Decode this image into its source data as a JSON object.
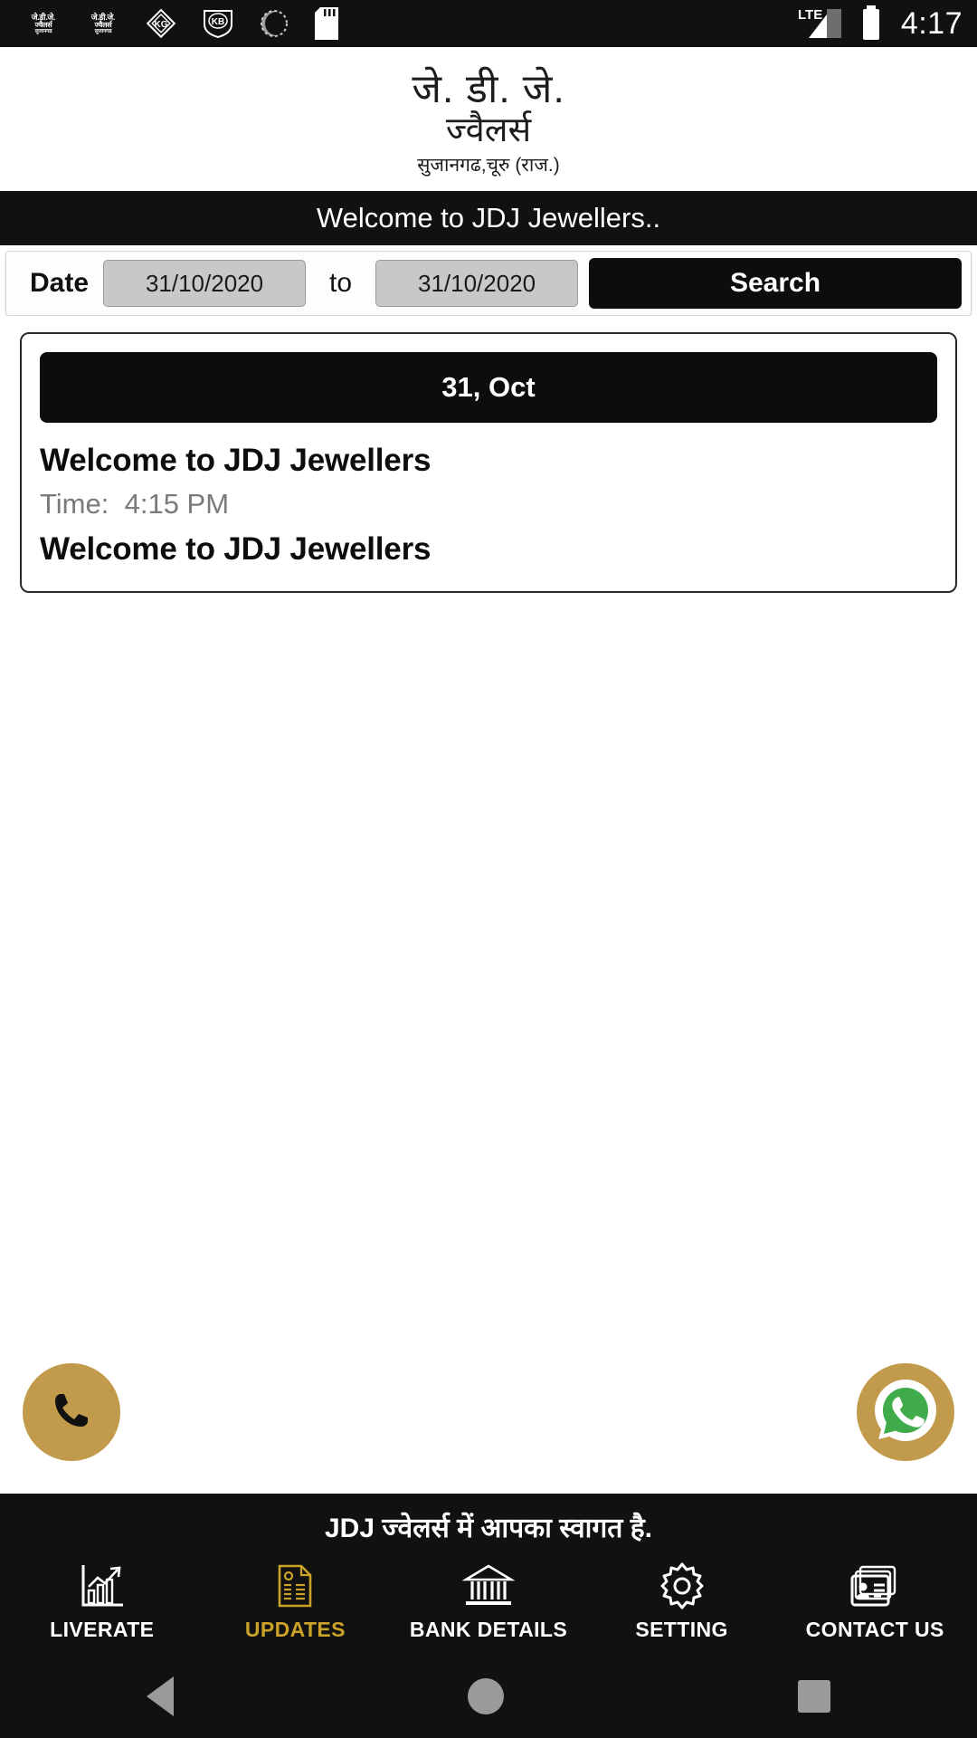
{
  "statusbar": {
    "notification_icons": [
      "jdj-app-notification",
      "jdj-app-notification",
      "kg-diamond-notification",
      "kb-shield-notification",
      "sync-progress-notification",
      "sd-card-notification"
    ],
    "notif_logo_line1": "जे.डी.जे.",
    "notif_logo_line2": "ज्वैलर्स",
    "notif_logo_line3": "सुजानगढ",
    "network_label": "LTE",
    "battery_icon": "battery-full-icon",
    "time": "4:17"
  },
  "header": {
    "logo_line1": "जे. डी. जे.",
    "logo_line2": "ज्वैलर्स",
    "logo_line3": "सुजानगढ,चूरु (राज.)"
  },
  "welcome_bar": {
    "text": "Welcome to JDJ Jewellers.."
  },
  "search": {
    "date_label": "Date",
    "from_date": "31/10/2020",
    "to_label": "to",
    "to_date": "31/10/2020",
    "search_button": "Search"
  },
  "update_card": {
    "date_header": "31, Oct",
    "title": "Welcome to JDJ Jewellers",
    "time_label": "Time:",
    "time_value": "4:15 PM",
    "message": "Welcome to JDJ Jewellers"
  },
  "fabs": {
    "call_icon": "phone-icon",
    "whatsapp_icon": "whatsapp-icon",
    "accent_color": "#c19a4b"
  },
  "footer": {
    "marquee": "JDJ ज्वेलर्स में आपका स्वागत है.",
    "nav": [
      {
        "label": "LIVERATE",
        "icon": "growth-chart-icon",
        "active": false
      },
      {
        "label": "UPDATES",
        "icon": "document-list-icon",
        "active": true
      },
      {
        "label": "BANK DETAILS",
        "icon": "bank-icon",
        "active": false
      },
      {
        "label": "SETTING",
        "icon": "gear-icon",
        "active": false
      },
      {
        "label": "CONTACT US",
        "icon": "contact-card-icon",
        "active": false
      }
    ],
    "active_color": "#c9a227"
  },
  "system_nav": {
    "back": "back-icon",
    "home": "home-icon",
    "recents": "recents-icon"
  }
}
